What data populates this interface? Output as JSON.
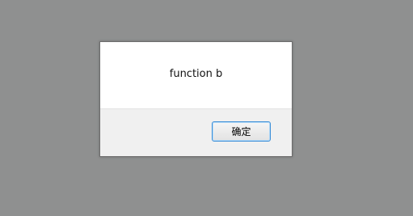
{
  "dialog": {
    "message": "function b",
    "ok_button_label": "确定"
  }
}
